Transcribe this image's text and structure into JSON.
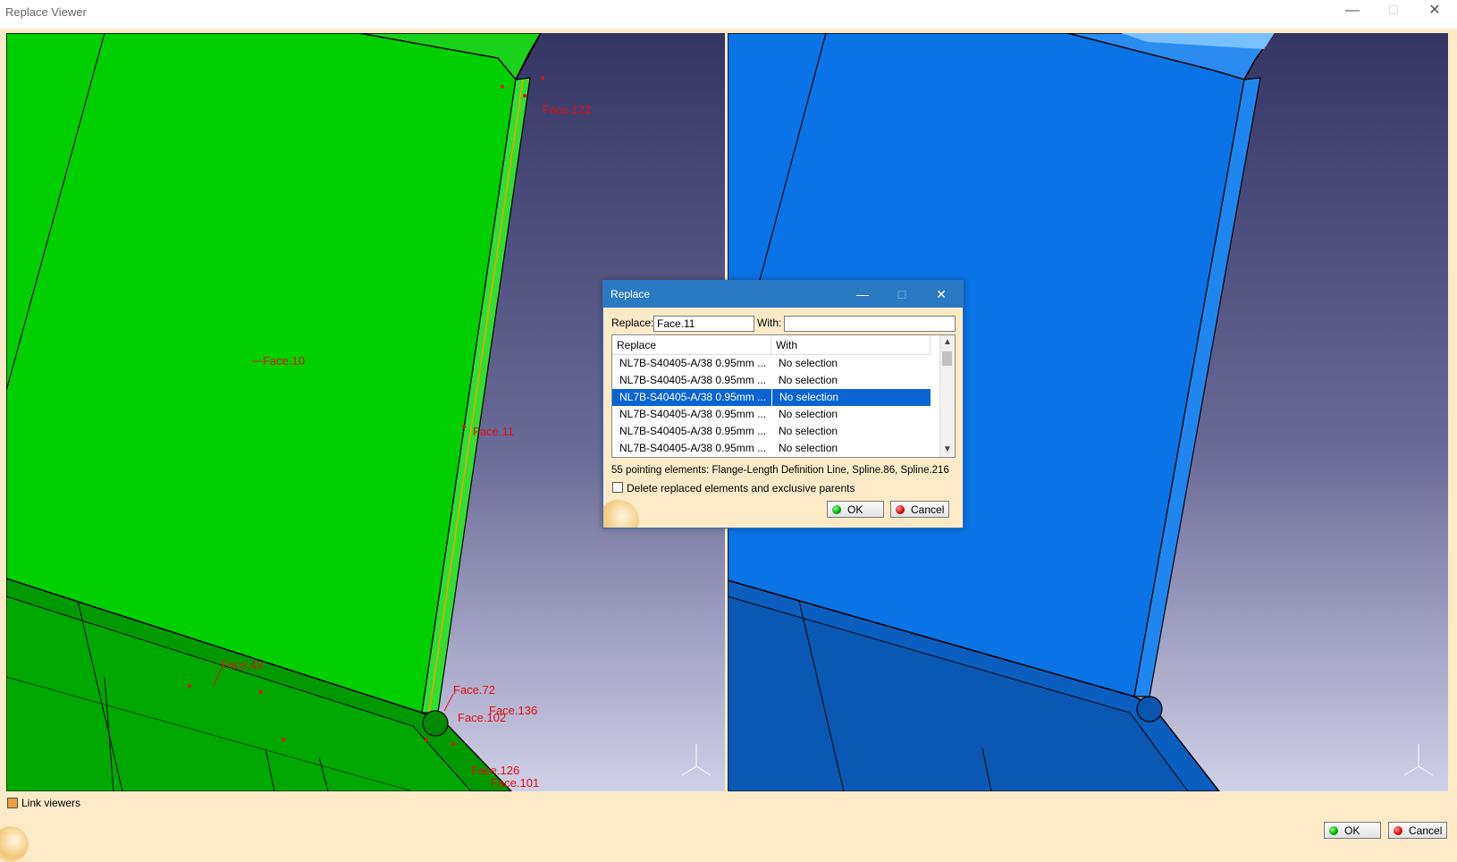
{
  "window": {
    "title": "Replace Viewer",
    "minimize_icon": "minimize-icon",
    "maximize_icon": "maximize-icon",
    "close_icon": "close-icon"
  },
  "left_viewer": {
    "labels": [
      "Face.10",
      "Face.11",
      "Face.43",
      "Face.72",
      "Face.136",
      "Face.102",
      "Face.126",
      "Face.101",
      "Face.122"
    ]
  },
  "bottom": {
    "link_viewers_label": "Link viewers",
    "ok_label": "OK",
    "cancel_label": "Cancel"
  },
  "dialog": {
    "title": "Replace",
    "replace_label": "Replace:",
    "replace_value": "Face.11",
    "with_label": "With:",
    "with_value": "",
    "columns": [
      "Replace",
      "With"
    ],
    "rows": [
      {
        "replace": "NL7B-S40405-A/38 0.95mm ...",
        "with": "No selection"
      },
      {
        "replace": "NL7B-S40405-A/38 0.95mm ...",
        "with": "No selection"
      },
      {
        "replace": "NL7B-S40405-A/38 0.95mm ...",
        "with": "No selection"
      },
      {
        "replace": "NL7B-S40405-A/38 0.95mm ...",
        "with": "No selection"
      },
      {
        "replace": "NL7B-S40405-A/38 0.95mm ...",
        "with": "No selection"
      },
      {
        "replace": "NL7B-S40405-A/38 0.95mm ...",
        "with": "No selection"
      }
    ],
    "selected_row": 2,
    "pointing_text": "55 pointing elements: Flange-Length Definition Line, Spline.86, Spline.216",
    "delete_label": "Delete replaced elements and exclusive parents",
    "ok_label": "OK",
    "cancel_label": "Cancel"
  },
  "colors": {
    "left_part": "#00d400",
    "right_part": "#0a74e6",
    "background_top": "#3a3a6e",
    "background_bottom": "#d4d4e8",
    "dialog_title": "#2b79c2",
    "panel": "#fdebc8"
  }
}
